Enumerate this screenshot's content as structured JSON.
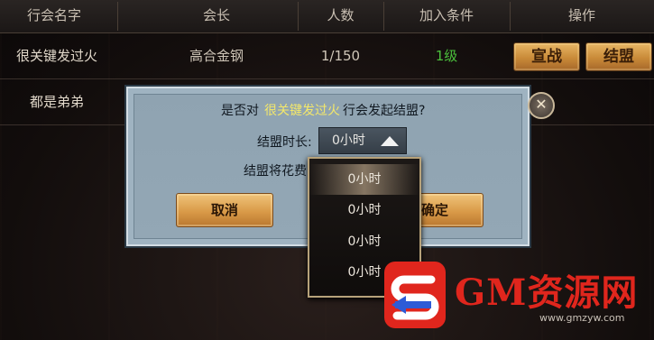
{
  "table": {
    "headers": [
      "行会名字",
      "会长",
      "人数",
      "加入条件",
      "操作"
    ],
    "rows": [
      {
        "name": "很关键发过火",
        "leader": "高合金钢",
        "members": "1/150",
        "condition": "1级",
        "actions": [
          "宣战",
          "结盟"
        ]
      },
      {
        "name": "都是弟弟",
        "leader": "",
        "members": "",
        "condition": "",
        "actions": []
      }
    ]
  },
  "dialog": {
    "message_pre": "是否对",
    "target_guild": "很关键发过火",
    "message_post": "行会发起结盟?",
    "duration_label": "结盟时长:",
    "duration_value": "0小时",
    "cost_label": "结盟将花费",
    "cancel_label": "取消",
    "confirm_label": "确定",
    "close_icon": "close-icon"
  },
  "dropdown": {
    "options": [
      "0小时",
      "0小时",
      "0小时",
      "0小时"
    ],
    "selected_index": 0
  },
  "watermark": {
    "text": "GM资源网",
    "url": "www.gmzyw.com"
  },
  "colors": {
    "level_green": "#4bbf3c",
    "guild_highlight": "#f4e86a",
    "watermark_red": "#e0261d",
    "button_gold": "#d99a48"
  }
}
